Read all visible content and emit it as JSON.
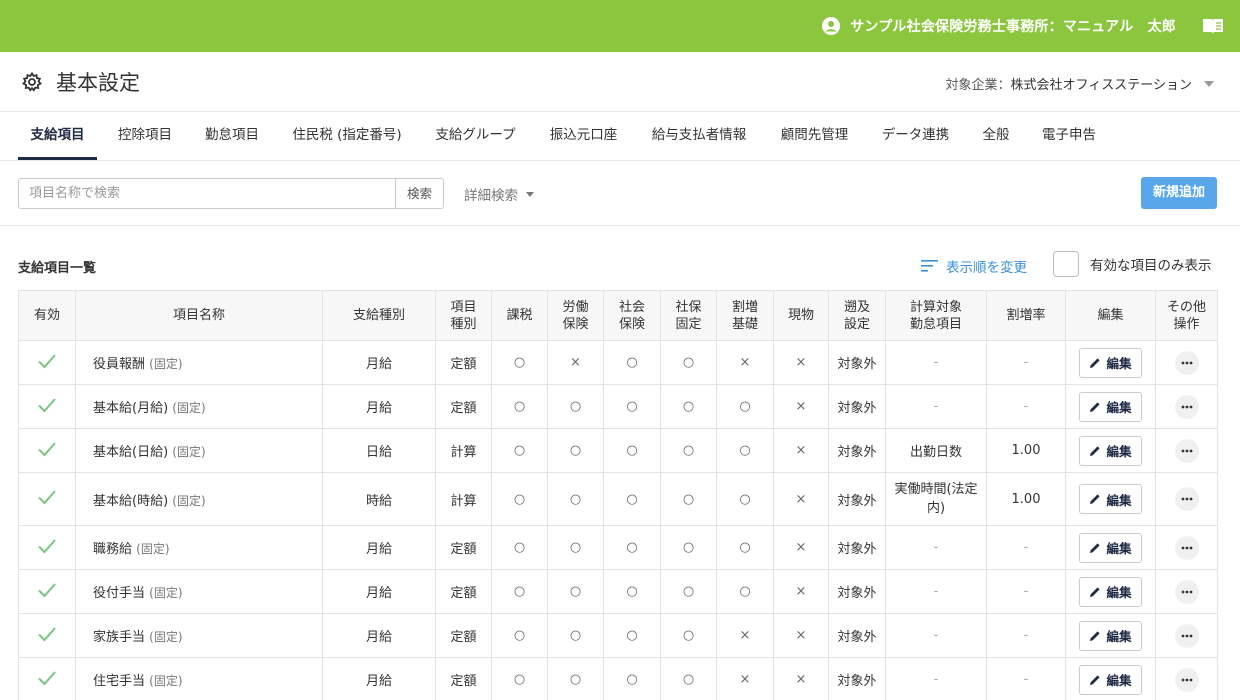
{
  "topbar": {
    "user_label": "サンプル社会保険労務士事務所：マニュアル　太郎",
    "accent": "#8cc63f"
  },
  "header": {
    "title": "基本設定",
    "company_label": "対象企業：",
    "company_name": "株式会社オフィスステーション"
  },
  "tabs": [
    {
      "label": "支給項目",
      "active": true
    },
    {
      "label": "控除項目"
    },
    {
      "label": "勤怠項目"
    },
    {
      "label": "住民税 (指定番号)"
    },
    {
      "label": "支給グループ"
    },
    {
      "label": "振込元口座"
    },
    {
      "label": "給与支払者情報"
    },
    {
      "label": "顧問先管理"
    },
    {
      "label": "データ連携"
    },
    {
      "label": "全般"
    },
    {
      "label": "電子申告"
    }
  ],
  "search": {
    "placeholder": "項目名称で検索",
    "button": "検索",
    "advanced": "詳細検索"
  },
  "new_button": "新規追加",
  "list": {
    "title": "支給項目一覧",
    "sort_change": "表示順を変更",
    "only_valid": "有効な項目のみ表示"
  },
  "table": {
    "headers": [
      "有効",
      "項目名称",
      "支給種別",
      "項目\n種別",
      "課税",
      "労働\n保険",
      "社会\n保険",
      "社保\n固定",
      "割増\n基礎",
      "現物",
      "遡及\n設定",
      "計算対象\n勤怠項目",
      "割増率",
      "編集",
      "その他\n操作"
    ],
    "edit_label": "編集",
    "fixed_tag": "(固定)",
    "rows": [
      {
        "name": "役員報酬",
        "pay_type": "月給",
        "item_type": "定額",
        "tax": "○",
        "labor": "×",
        "social": "○",
        "fixed": "○",
        "premium": "×",
        "kind": "×",
        "retro": "対象外",
        "target": "-",
        "rate": "-"
      },
      {
        "name": "基本給(月給)",
        "pay_type": "月給",
        "item_type": "定額",
        "tax": "○",
        "labor": "○",
        "social": "○",
        "fixed": "○",
        "premium": "○",
        "kind": "×",
        "retro": "対象外",
        "target": "-",
        "rate": "-"
      },
      {
        "name": "基本給(日給)",
        "pay_type": "日給",
        "item_type": "計算",
        "tax": "○",
        "labor": "○",
        "social": "○",
        "fixed": "○",
        "premium": "○",
        "kind": "×",
        "retro": "対象外",
        "target": "出勤日数",
        "rate": "1.00"
      },
      {
        "name": "基本給(時給)",
        "pay_type": "時給",
        "item_type": "計算",
        "tax": "○",
        "labor": "○",
        "social": "○",
        "fixed": "○",
        "premium": "○",
        "kind": "×",
        "retro": "対象外",
        "target": "実働時間(法定内)",
        "rate": "1.00"
      },
      {
        "name": "職務給",
        "pay_type": "月給",
        "item_type": "定額",
        "tax": "○",
        "labor": "○",
        "social": "○",
        "fixed": "○",
        "premium": "○",
        "kind": "×",
        "retro": "対象外",
        "target": "-",
        "rate": "-"
      },
      {
        "name": "役付手当",
        "pay_type": "月給",
        "item_type": "定額",
        "tax": "○",
        "labor": "○",
        "social": "○",
        "fixed": "○",
        "premium": "○",
        "kind": "×",
        "retro": "対象外",
        "target": "-",
        "rate": "-"
      },
      {
        "name": "家族手当",
        "pay_type": "月給",
        "item_type": "定額",
        "tax": "○",
        "labor": "○",
        "social": "○",
        "fixed": "○",
        "premium": "×",
        "kind": "×",
        "retro": "対象外",
        "target": "-",
        "rate": "-"
      },
      {
        "name": "住宅手当",
        "pay_type": "月給",
        "item_type": "定額",
        "tax": "○",
        "labor": "○",
        "social": "○",
        "fixed": "○",
        "premium": "×",
        "kind": "×",
        "retro": "対象外",
        "target": "-",
        "rate": "-"
      }
    ]
  }
}
